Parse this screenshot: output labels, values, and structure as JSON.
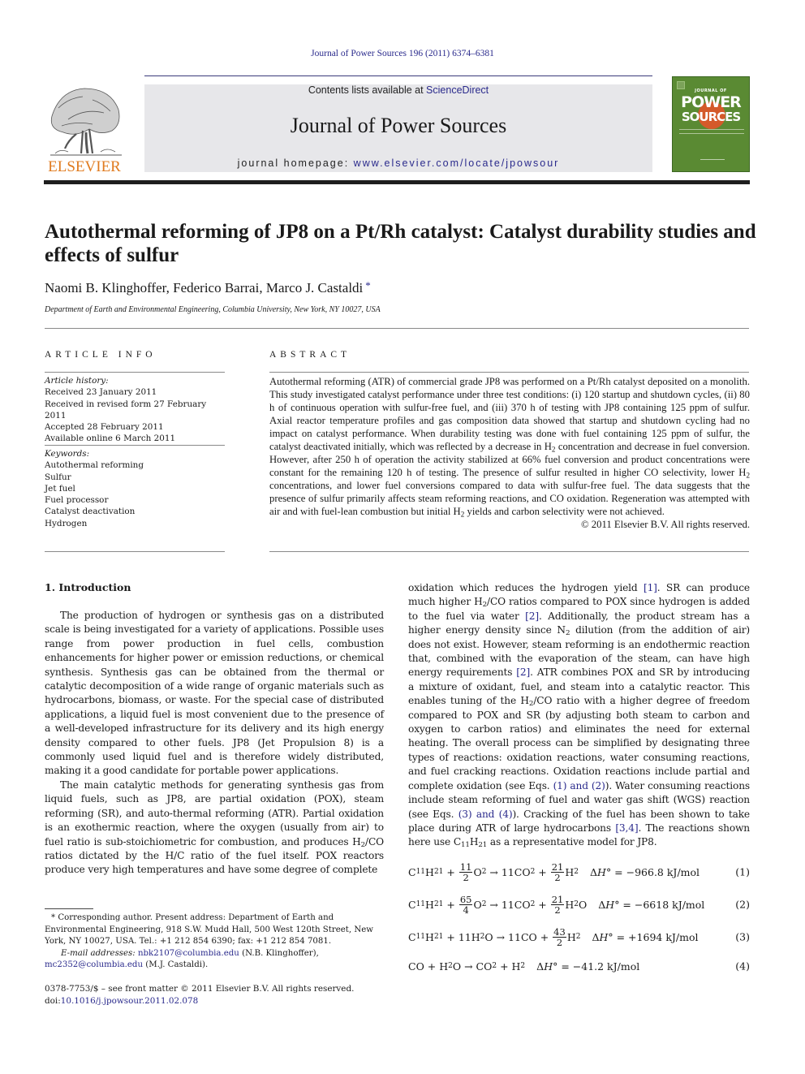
{
  "running_head": "Journal of Power Sources 196 (2011) 6374–6381",
  "header": {
    "publisher": "ELSEVIER",
    "contents_prefix": "Contents lists available at ",
    "contents_link": "ScienceDirect",
    "journal_title": "Journal of Power Sources",
    "homepage_prefix": "journal homepage: ",
    "homepage_link": "www.elsevier.com/locate/jpowsour",
    "cover": {
      "line1": "JOURNAL OF",
      "line2": "POWER",
      "line3": "SOURCES",
      "background_color": "#5a8a33",
      "accent_color": "#d45a2a"
    }
  },
  "article": {
    "title": "Autothermal reforming of JP8 on a Pt/Rh catalyst: Catalyst durability studies and effects of sulfur",
    "authors": "Naomi B. Klinghoffer, Federico Barrai, Marco J. Castaldi",
    "corresponding_marker": "*",
    "affiliation": "Department of Earth and Environmental Engineering, Columbia University, New York, NY 10027, USA"
  },
  "article_info": {
    "heading": "ARTICLE INFO",
    "history_label": "Article history:",
    "history": [
      "Received 23 January 2011",
      "Received in revised form 27 February 2011",
      "Accepted 28 February 2011",
      "Available online 6 March 2011"
    ],
    "keywords_label": "Keywords:",
    "keywords": [
      "Autothermal reforming",
      "Sulfur",
      "Jet fuel",
      "Fuel processor",
      "Catalyst deactivation",
      "Hydrogen"
    ]
  },
  "abstract": {
    "heading": "ABSTRACT",
    "p1": "Autothermal reforming (ATR) of commercial grade JP8 was performed on a Pt/Rh catalyst deposited on a monolith. This study investigated catalyst performance under three test conditions: (i) 120 startup and shutdown cycles, (ii) 80 h of continuous operation with sulfur-free fuel, and (iii) 370 h of testing with JP8 containing 125 ppm of sulfur. Axial reactor temperature profiles and gas composition data showed that startup and shutdown cycling had no impact on catalyst performance. When durability testing was done with fuel containing 125 ppm of sulfur, the catalyst deactivated initially, which was reflected by a decrease in H",
    "p2": " concentration and decrease in fuel conversion. However, after 250 h of operation the activity stabilized at 66% fuel conversion and product concentrations were constant for the remaining 120 h of testing. The presence of sulfur resulted in higher CO selectivity, lower H",
    "p3": " concentrations, and lower fuel conversions compared to data with sulfur-free fuel. The data suggests that the presence of sulfur primarily affects steam reforming reactions, and CO oxidation. Regeneration was attempted with air and with fuel-lean combustion but initial H",
    "p4": " yields and carbon selectivity were not achieved.",
    "sub2": "2",
    "copyright": "© 2011 Elsevier B.V. All rights reserved."
  },
  "intro": {
    "heading": "1.  Introduction",
    "para1": "The production of hydrogen or synthesis gas on a distributed scale is being investigated for a variety of applications. Possible uses range from power production in fuel cells, combustion enhancements for higher power or emission reductions, or chemical synthesis. Synthesis gas can be obtained from the thermal or catalytic decomposition of a wide range of organic materials such as hydrocarbons, biomass, or waste. For the special case of distributed applications, a liquid fuel is most convenient due to the presence of a well-developed infrastructure for its delivery and its high energy density compared to other fuels. JP8 (Jet Propulsion 8) is a commonly used liquid fuel and is therefore widely distributed, making it a good candidate for portable power applications.",
    "para2a": "The main catalytic methods for generating synthesis gas from liquid fuels, such as JP8, are partial oxidation (POX), steam reforming (SR), and auto-thermal reforming (ATR). Partial oxidation is an exothermic reaction, where the oxygen (usually from air) to fuel ratio is sub-stoichiometric for combustion, and produces H",
    "para2b": "/CO ratios dictated by the H/C ratio of the fuel itself. POX reactors produce very high temperatures and have some degree of complete",
    "right_col": {
      "s1": "oxidation which reduces the hydrogen yield ",
      "ref1": "[1]",
      "s2": ". SR can produce much higher H",
      "s3": "/CO ratios compared to POX since hydrogen is added to the fuel via water ",
      "ref2": "[2]",
      "s4": ". Additionally, the product stream has a higher energy density since N",
      "s5": " dilution (from the addition of air) does not exist. However, steam reforming is an endothermic reaction that, combined with the evaporation of the steam, can have high energy requirements ",
      "ref3": "[2]",
      "s6": ". ATR combines POX and SR by introducing a mixture of oxidant, fuel, and steam into a catalytic reactor. This enables tuning of the H",
      "s7": "/CO ratio with a higher degree of freedom compared to POX and SR (by adjusting both steam to carbon and oxygen to carbon ratios) and eliminates the need for external heating. The overall process can be simplified by designating three types of reactions: oxidation reactions, water consuming reactions, and fuel cracking reactions. Oxidation reactions include partial and complete oxidation (see Eqs. ",
      "ref4": "(1) and (2)",
      "s8": "). Water consuming reactions include steam reforming of fuel and water gas shift (WGS) reaction (see Eqs. ",
      "ref5": "(3) and (4)",
      "s9": "). Cracking of the fuel has been shown to take place during ATR of large hydrocarbons ",
      "ref6": "[3,4]",
      "s10": ". The reactions shown here use C",
      "sub11": "11",
      "s11": "H",
      "sub21": "21",
      "s12": " as a representative model for JP8."
    }
  },
  "equations": [
    {
      "lhs": "C11H21 + 11/2 O2",
      "rhs": "11CO2 + 21/2 H2",
      "dh": "ΔH° = −966.8 kJ/mol",
      "number": "(1)"
    },
    {
      "lhs": "C11H21 + 65/4 O2",
      "rhs": "11CO2 + 21/2 H2O",
      "dh": "ΔH° = −6618 kJ/mol",
      "number": "(2)"
    },
    {
      "lhs": "C11H21 + 11H2O",
      "rhs": "11CO + 43/2 H2",
      "dh": "ΔH° = +1694 kJ/mol",
      "number": "(3)"
    },
    {
      "lhs": "CO + H2O",
      "rhs": "CO2 + H2",
      "dh": "ΔH° = −41.2 kJ/mol",
      "number": "(4)"
    }
  ],
  "eq_parts": {
    "c": "C",
    "h": "H",
    "o": "O",
    "co": "CO",
    "n11": "11",
    "n21": "21",
    "n2": "2",
    "plus": " + ",
    "arrow": " → ",
    "f1n": "11",
    "f1d": "2",
    "f2n": "21",
    "f2d": "2",
    "f3n": "65",
    "f3d": "4",
    "f4n": "43",
    "f4d": "2",
    "eleven": "11",
    "delta": "Δ",
    "Hsym": "H",
    "deg": "°",
    "v1": " = −966.8 kJ/mol",
    "v2": " = −6618 kJ/mol",
    "v3": " = +1694 kJ/mol",
    "v4": " = −41.2 kJ/mol",
    "num1": "(1)",
    "num2": "(2)",
    "num3": "(3)",
    "num4": "(4)"
  },
  "footnotes": {
    "corresponding": "*  Corresponding author. Present address: Department of Earth and Environmental Engineering, 918 S.W. Mudd Hall, 500 West 120th Street, New York, NY 10027, USA. Tel.: +1 212 854 6390; fax: +1 212 854 7081.",
    "email_label": "E-mail addresses: ",
    "email1": "nbk2107@columbia.edu",
    "email1_name": " (N.B. Klinghoffer),",
    "email2": "mc2352@columbia.edu",
    "email2_name": " (M.J. Castaldi)."
  },
  "front_matter": {
    "issn_line": "0378-7753/$ – see front matter © 2011 Elsevier B.V. All rights reserved.",
    "doi_prefix": "doi:",
    "doi": "10.1016/j.jpowsour.2011.02.078"
  },
  "colors": {
    "link": "#2a2a8c",
    "publisher_orange": "#e07b1f",
    "header_box": "#e7e7ea"
  }
}
